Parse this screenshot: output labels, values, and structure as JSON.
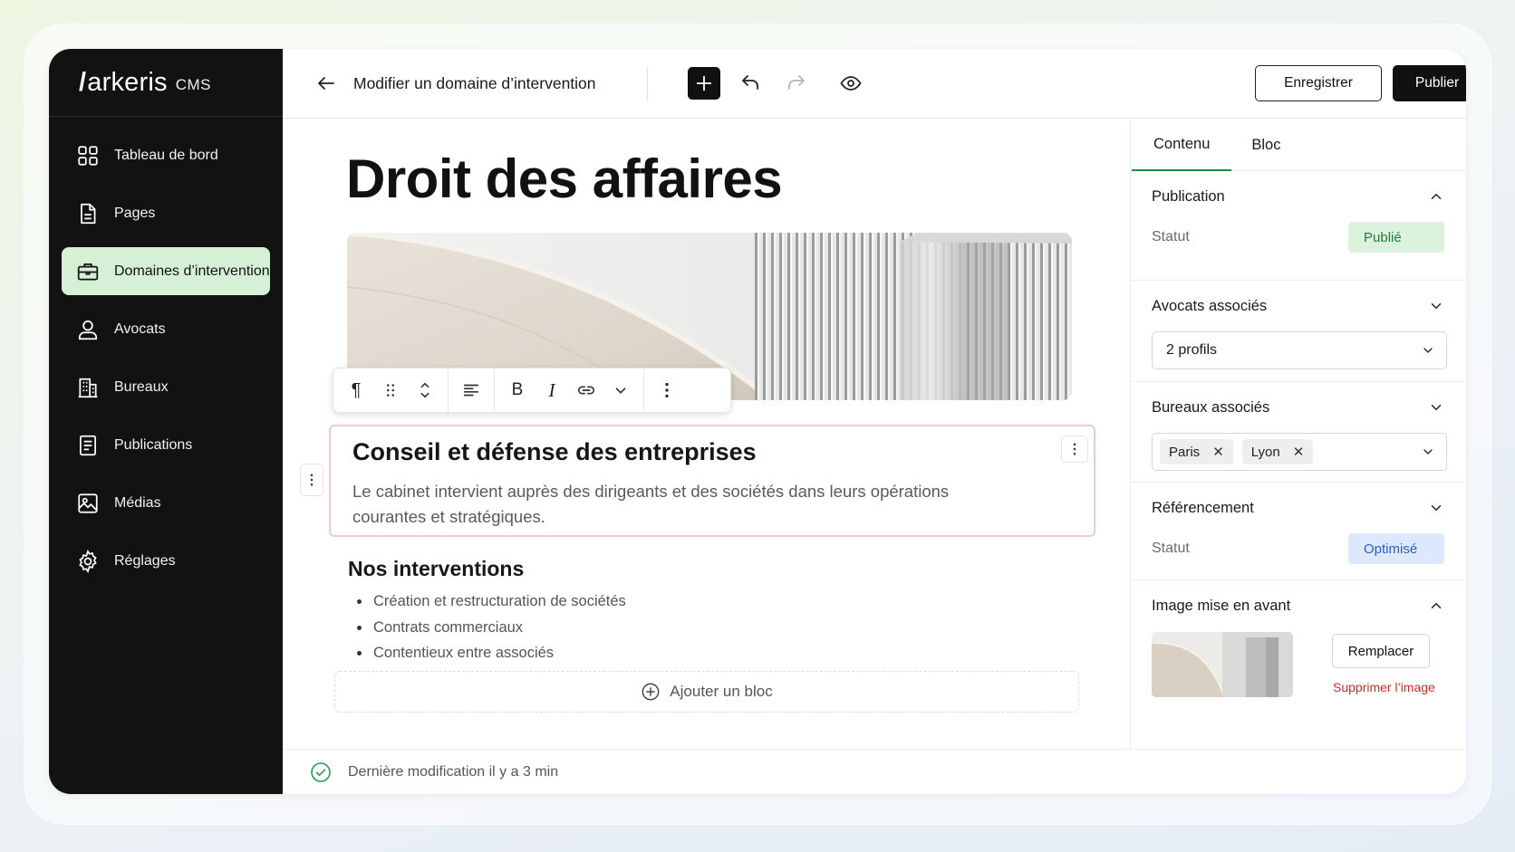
{
  "brand": {
    "logo": "arkeris",
    "logo_slash": "/",
    "suffix": "CMS"
  },
  "sidebar": {
    "items": [
      {
        "label": "Tableau de bord",
        "icon": "dashboard-grid-icon",
        "active": false
      },
      {
        "label": "Pages",
        "icon": "document-icon",
        "active": false
      },
      {
        "label": "Domaines d’intervention",
        "icon": "briefcase-icon",
        "active": true
      },
      {
        "label": "Avocats",
        "icon": "user-icon",
        "active": false
      },
      {
        "label": "Bureaux",
        "icon": "building-icon",
        "active": false
      },
      {
        "label": "Publications",
        "icon": "list-document-icon",
        "active": false
      },
      {
        "label": "Médias",
        "icon": "image-icon",
        "active": false
      },
      {
        "label": "Réglages",
        "icon": "gear-icon",
        "active": false
      }
    ]
  },
  "topbar": {
    "title": "Modifier un domaine d’intervention",
    "save_label": "Enregistrer",
    "publish_label": "Publier"
  },
  "editor": {
    "title": "Droit des affaires",
    "selected_block": {
      "heading": "Conseil et défense des entreprises",
      "text": "Le cabinet intervient auprès des dirigeants et des sociétés dans leurs opérations courantes et stratégiques."
    },
    "section_heading": "Nos interventions",
    "bullets": [
      "Création et restructuration de sociétés",
      "Contrats commerciaux",
      "Contentieux entre associés"
    ],
    "add_block_label": "Ajouter un bloc",
    "toolbar": {
      "paragraph_glyph": "¶",
      "bold": "B",
      "italic": "I"
    }
  },
  "status_bar": {
    "text": "Dernière modification il y a 3 min"
  },
  "panel": {
    "tabs": [
      "Contenu",
      "Bloc"
    ],
    "active_tab": "Contenu",
    "publication": {
      "title": "Publication",
      "status_label": "Statut",
      "status_value": "Publié",
      "expanded": true
    },
    "lawyers": {
      "title": "Avocats associés",
      "value": "2 profils",
      "expanded": false
    },
    "offices": {
      "title": "Bureaux associés",
      "chips": [
        "Paris",
        "Lyon"
      ],
      "expanded": false
    },
    "seo": {
      "title": "Référencement",
      "status_label": "Statut",
      "status_value": "Optimisé",
      "expanded": false
    },
    "featured_image": {
      "title": "Image mise en avant",
      "replace_label": "Remplacer",
      "delete_label": "Supprimer l’image",
      "expanded": true
    }
  },
  "colors": {
    "sidebar_bg": "#121212",
    "active_nav_bg": "#d6f0d6",
    "accent_green": "#1b8a4a",
    "selected_block_border": "#f2c7d6",
    "published_badge": "#dcf2dc",
    "optimized_badge": "#dce8fb",
    "danger": "#d62b2b"
  }
}
